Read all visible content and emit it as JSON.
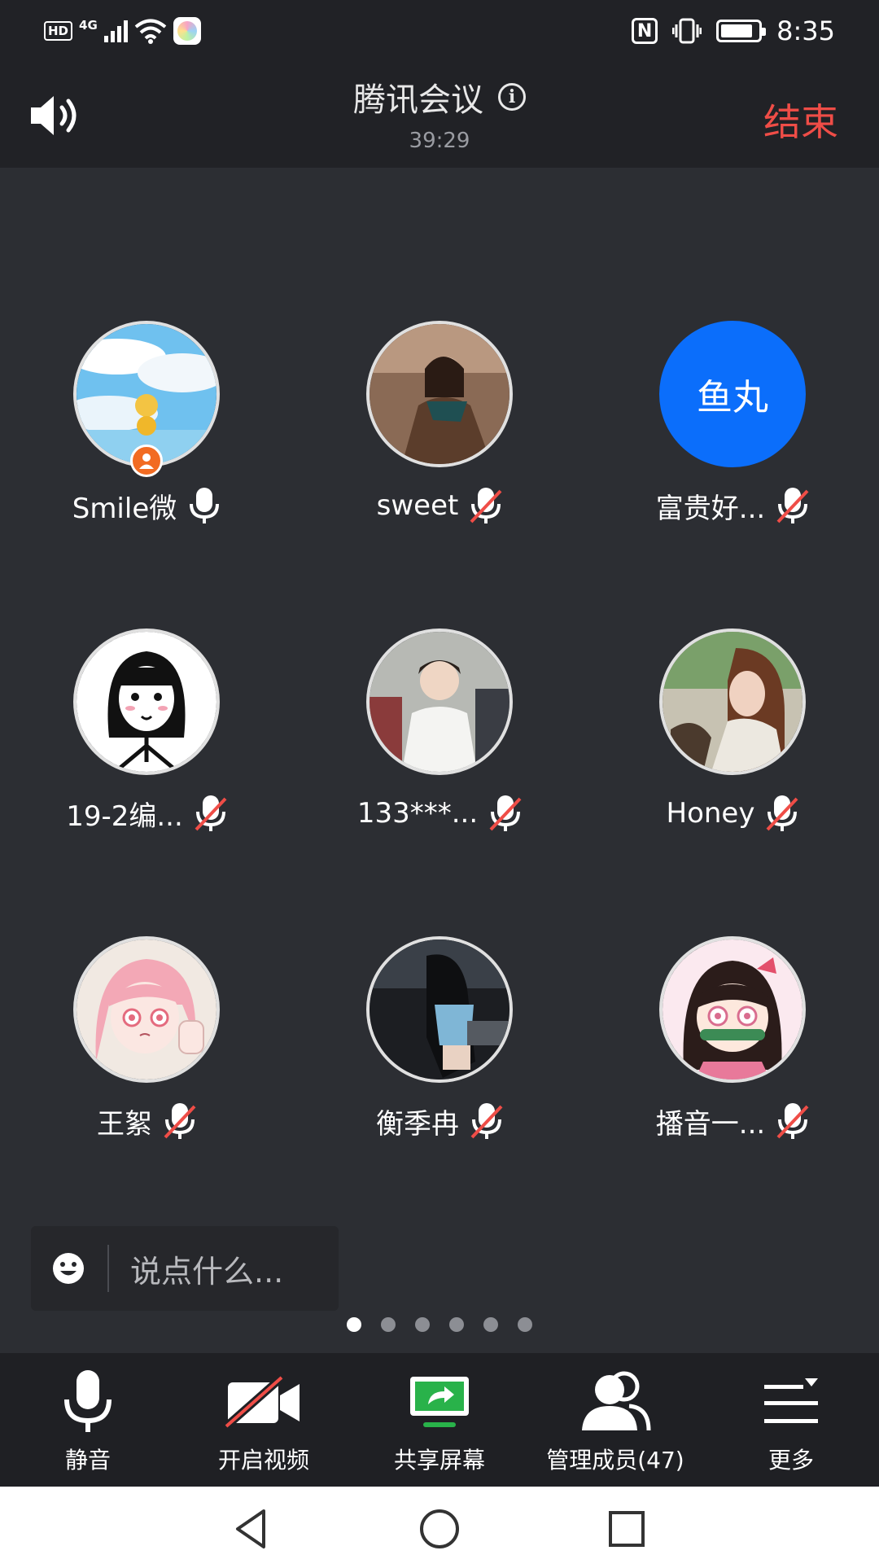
{
  "status_bar": {
    "hd": "HD",
    "network": "4G",
    "nfc": "N",
    "time": "8:35"
  },
  "header": {
    "title": "腾讯会议",
    "timer": "39:29",
    "end_label": "结束",
    "end_color": "#ef4d47"
  },
  "participants": [
    {
      "name": "Smile微",
      "mic": "on",
      "avatar": "photo-sky",
      "host": true
    },
    {
      "name": "sweet",
      "mic": "muted",
      "avatar": "photo-girl-scarf"
    },
    {
      "name": "富贵好...",
      "mic": "muted",
      "avatar_text": "鱼丸",
      "avatar_color": "#0b6efb"
    },
    {
      "name": "19-2编...",
      "mic": "muted",
      "avatar": "drawing-black-hair"
    },
    {
      "name": "133***...",
      "mic": "muted",
      "avatar": "photo-boy-white-shirt"
    },
    {
      "name": "Honey",
      "mic": "muted",
      "avatar": "photo-girl-brown-hair"
    },
    {
      "name": "王絮",
      "mic": "muted",
      "avatar": "anime-pink-hair"
    },
    {
      "name": "衡季冉",
      "mic": "muted",
      "avatar": "photo-girl-dark"
    },
    {
      "name": "播音一...",
      "mic": "muted",
      "avatar": "anime-nezuko"
    }
  ],
  "chat": {
    "placeholder": "说点什么..."
  },
  "pager": {
    "pages": 6,
    "current": 1
  },
  "toolbar": {
    "mute_label": "静音",
    "video_label": "开启视频",
    "share_label": "共享屏幕",
    "members_label": "管理成员(47)",
    "more_label": "更多"
  }
}
